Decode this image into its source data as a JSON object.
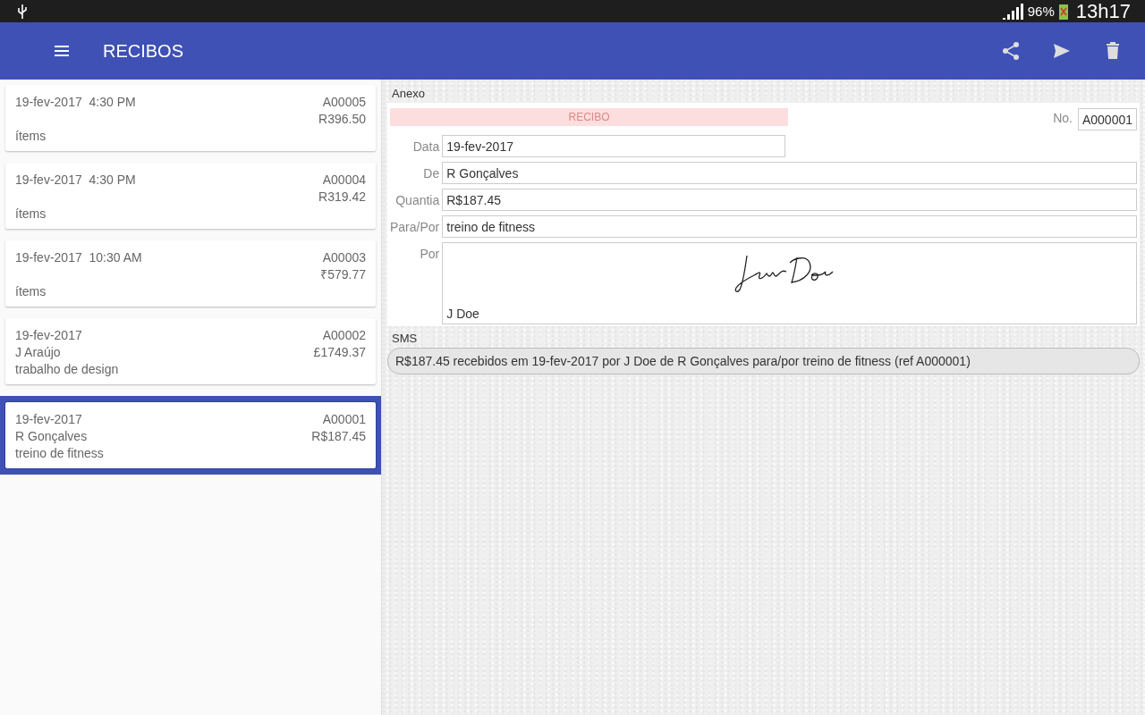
{
  "status_bar": {
    "battery": "96%",
    "time": "13h17"
  },
  "app_bar": {
    "title": "RECIBOS"
  },
  "receipts": [
    {
      "date": "19-fev-2017  4:30 PM",
      "number": "A00005",
      "amount": "R396.50",
      "lines": [
        "ítems"
      ],
      "selected": false
    },
    {
      "date": "19-fev-2017  4:30 PM",
      "number": "A00004",
      "amount": "R319.42",
      "lines": [
        "ítems"
      ],
      "selected": false
    },
    {
      "date": "19-fev-2017  10:30 AM",
      "number": "A00003",
      "amount": "₹579.77",
      "lines": [
        "ítems"
      ],
      "selected": false
    },
    {
      "date": "19-fev-2017",
      "number": "A00002",
      "amount": "£1749.37",
      "lines": [
        "J Araújo",
        "trabalho de design"
      ],
      "selected": false
    },
    {
      "date": "19-fev-2017",
      "number": "A00001",
      "amount": "R$187.45",
      "lines": [
        "R Gonçalves",
        "treino de fitness"
      ],
      "selected": true
    }
  ],
  "detail": {
    "attachment_label": "Anexo",
    "banner": "RECIBO",
    "number_label": "No.",
    "number": "A000001",
    "fields": [
      {
        "label": "Data",
        "value": "19-fev-2017",
        "short": true
      },
      {
        "label": "De",
        "value": "R Gonçalves",
        "short": false
      },
      {
        "label": "Quantia",
        "value": "R$187.45",
        "short": false
      },
      {
        "label": "Para/Por",
        "value": "treino de fitness",
        "short": false
      }
    ],
    "signature": {
      "label": "Por",
      "name": "J Doe"
    },
    "sms_label": "SMS",
    "sms": "R$187.45 recebidos em 19-fev-2017 por J Doe de R Gonçalves para/por treino de fitness (ref A000001)"
  }
}
